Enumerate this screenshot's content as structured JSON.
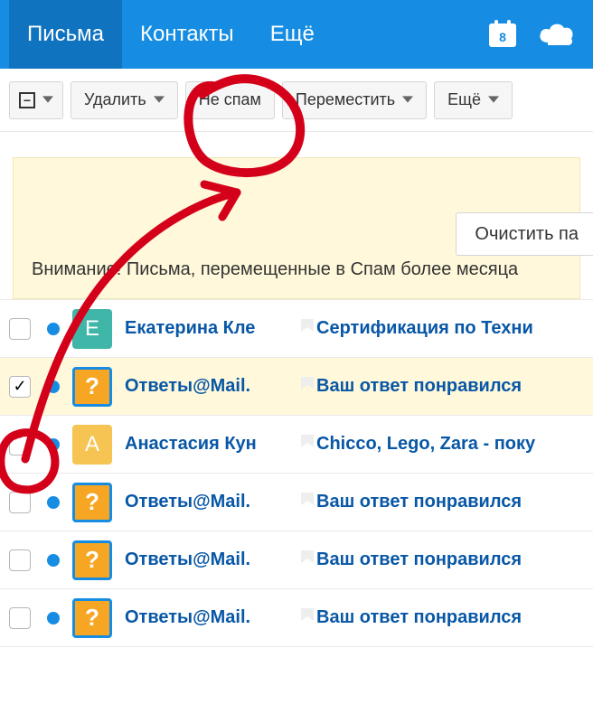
{
  "nav": {
    "mail": "Письма",
    "contacts": "Контакты",
    "more": "Ещё",
    "calendar_day": "8"
  },
  "toolbar": {
    "delete": "Удалить",
    "not_spam": "Не спам",
    "move": "Переместить",
    "more": "Ещё"
  },
  "notice": {
    "clear": "Очистить па",
    "text": "Внимание! Письма, перемещенные в Спам более месяца"
  },
  "rows": [
    {
      "checked": false,
      "avatar_kind": "letter-e",
      "avatar_text": "Е",
      "from": "Екатерина Кле",
      "subject": "Сертификация по Техни"
    },
    {
      "checked": true,
      "avatar_kind": "q",
      "avatar_text": "?",
      "from": "Ответы@Mail.",
      "subject": "Ваш ответ понравился"
    },
    {
      "checked": false,
      "avatar_kind": "letter-a",
      "avatar_text": "А",
      "from": "Анастасия Кун",
      "subject": "Chicco, Lego, Zara - поку"
    },
    {
      "checked": false,
      "avatar_kind": "q",
      "avatar_text": "?",
      "from": "Ответы@Mail.",
      "subject": "Ваш ответ понравился"
    },
    {
      "checked": false,
      "avatar_kind": "q",
      "avatar_text": "?",
      "from": "Ответы@Mail.",
      "subject": "Ваш ответ понравился"
    },
    {
      "checked": false,
      "avatar_kind": "q",
      "avatar_text": "?",
      "from": "Ответы@Mail.",
      "subject": "Ваш ответ понравился"
    }
  ]
}
